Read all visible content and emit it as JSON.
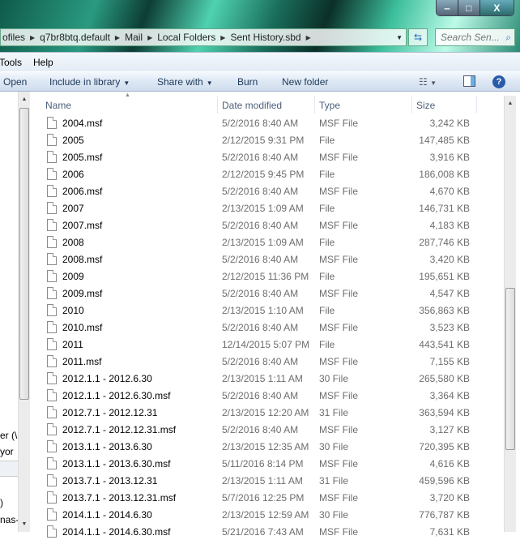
{
  "window": {
    "minimize": "‒",
    "maximize": "□",
    "close": "X"
  },
  "address": {
    "crumbs": [
      "ofiles",
      "q7br8btq.default",
      "Mail",
      "Local Folders",
      "Sent History.sbd"
    ],
    "search_placeholder": "Search Sen..."
  },
  "menu": [
    "Tools",
    "Help"
  ],
  "toolbar": {
    "open": "Open",
    "include": "Include in library",
    "share": "Share with",
    "burn": "Burn",
    "new_folder": "New folder"
  },
  "left_pane": [
    "er (\\",
    "yor",
    ")",
    "nas-"
  ],
  "columns": {
    "name": "Name",
    "date": "Date modified",
    "type": "Type",
    "size": "Size"
  },
  "files": [
    {
      "name": "2004.msf",
      "date": "5/2/2016 8:40 AM",
      "type": "MSF File",
      "size": "3,242 KB"
    },
    {
      "name": "2005",
      "date": "2/12/2015 9:31 PM",
      "type": "File",
      "size": "147,485 KB"
    },
    {
      "name": "2005.msf",
      "date": "5/2/2016 8:40 AM",
      "type": "MSF File",
      "size": "3,916 KB"
    },
    {
      "name": "2006",
      "date": "2/12/2015 9:45 PM",
      "type": "File",
      "size": "186,008 KB"
    },
    {
      "name": "2006.msf",
      "date": "5/2/2016 8:40 AM",
      "type": "MSF File",
      "size": "4,670 KB"
    },
    {
      "name": "2007",
      "date": "2/13/2015 1:09 AM",
      "type": "File",
      "size": "146,731 KB"
    },
    {
      "name": "2007.msf",
      "date": "5/2/2016 8:40 AM",
      "type": "MSF File",
      "size": "4,183 KB"
    },
    {
      "name": "2008",
      "date": "2/13/2015 1:09 AM",
      "type": "File",
      "size": "287,746 KB"
    },
    {
      "name": "2008.msf",
      "date": "5/2/2016 8:40 AM",
      "type": "MSF File",
      "size": "3,420 KB"
    },
    {
      "name": "2009",
      "date": "2/12/2015 11:36 PM",
      "type": "File",
      "size": "195,651 KB"
    },
    {
      "name": "2009.msf",
      "date": "5/2/2016 8:40 AM",
      "type": "MSF File",
      "size": "4,547 KB"
    },
    {
      "name": "2010",
      "date": "2/13/2015 1:10 AM",
      "type": "File",
      "size": "356,863 KB"
    },
    {
      "name": "2010.msf",
      "date": "5/2/2016 8:40 AM",
      "type": "MSF File",
      "size": "3,523 KB"
    },
    {
      "name": "2011",
      "date": "12/14/2015 5:07 PM",
      "type": "File",
      "size": "443,541 KB"
    },
    {
      "name": "2011.msf",
      "date": "5/2/2016 8:40 AM",
      "type": "MSF File",
      "size": "7,155 KB"
    },
    {
      "name": "2012.1.1 - 2012.6.30",
      "date": "2/13/2015 1:11 AM",
      "type": "30 File",
      "size": "265,580 KB"
    },
    {
      "name": "2012.1.1 - 2012.6.30.msf",
      "date": "5/2/2016 8:40 AM",
      "type": "MSF File",
      "size": "3,364 KB"
    },
    {
      "name": "2012.7.1 - 2012.12.31",
      "date": "2/13/2015 12:20 AM",
      "type": "31 File",
      "size": "363,594 KB"
    },
    {
      "name": "2012.7.1 - 2012.12.31.msf",
      "date": "5/2/2016 8:40 AM",
      "type": "MSF File",
      "size": "3,127 KB"
    },
    {
      "name": "2013.1.1 - 2013.6.30",
      "date": "2/13/2015 12:35 AM",
      "type": "30 File",
      "size": "720,395 KB"
    },
    {
      "name": "2013.1.1 - 2013.6.30.msf",
      "date": "5/11/2016 8:14 PM",
      "type": "MSF File",
      "size": "4,616 KB"
    },
    {
      "name": "2013.7.1 - 2013.12.31",
      "date": "2/13/2015 1:11 AM",
      "type": "31 File",
      "size": "459,596 KB"
    },
    {
      "name": "2013.7.1 - 2013.12.31.msf",
      "date": "5/7/2016 12:25 PM",
      "type": "MSF File",
      "size": "3,720 KB"
    },
    {
      "name": "2014.1.1 - 2014.6.30",
      "date": "2/13/2015 12:59 AM",
      "type": "30 File",
      "size": "776,787 KB"
    },
    {
      "name": "2014.1.1 - 2014.6.30.msf",
      "date": "5/21/2016 7:43 AM",
      "type": "MSF File",
      "size": "7,631 KB"
    }
  ]
}
